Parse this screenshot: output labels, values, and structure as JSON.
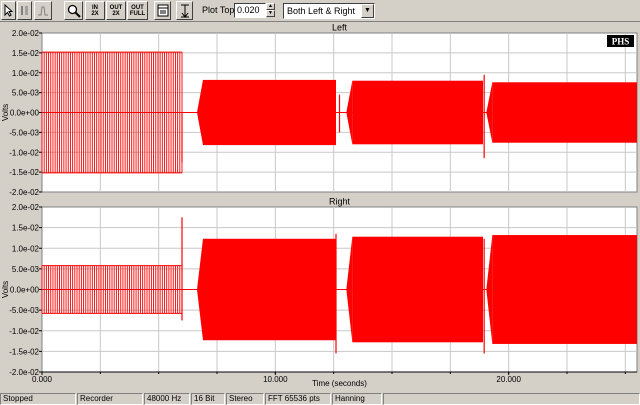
{
  "toolbar": {
    "zoom_in_label": [
      "IN",
      "2X"
    ],
    "zoom_out_label": [
      "OUT",
      "2X"
    ],
    "zoom_full_label": [
      "OUT",
      "FULL"
    ],
    "plot_top_label": "Plot Top:",
    "plot_top_value": "0.020",
    "channel_selected": "Both Left & Right"
  },
  "logo": "PHS",
  "chart_data": {
    "type": "line",
    "xlabel": "Time (seconds)",
    "x_ticks": [
      "0.000",
      "10.000",
      "20.000"
    ],
    "xlim": [
      0,
      25.5
    ],
    "color": "#ff0000",
    "panels": [
      {
        "title": "Left",
        "ylabel": "Volts",
        "ylim": [
          -0.02,
          0.02
        ],
        "y_ticks": [
          "2.0e-02",
          "1.5e-02",
          "1.0e-02",
          "5.0e-03",
          "0.0e+00",
          "-5.0e-03",
          "-1.0e-02",
          "-1.5e-02",
          "-2.0e-02"
        ],
        "segments": [
          {
            "t_start": 0.0,
            "t_end": 6.0,
            "amplitude": 0.0152,
            "style": "sparse"
          },
          {
            "t_start": 6.9,
            "t_end": 12.6,
            "amplitude": 0.0082,
            "style": "dense"
          },
          {
            "t_start": 13.3,
            "t_end": 18.9,
            "amplitude": 0.008,
            "style": "dense"
          },
          {
            "t_start": 19.3,
            "t_end": 25.5,
            "amplitude": 0.0076,
            "style": "dense"
          }
        ],
        "spikes": [
          {
            "t": 6.0,
            "top": 0.0,
            "bottom": -0.0125
          },
          {
            "t": 12.75,
            "top": 0.0045,
            "bottom": -0.005
          },
          {
            "t": 18.95,
            "top": 0.0095,
            "bottom": -0.0115
          }
        ]
      },
      {
        "title": "Right",
        "ylabel": "Volts",
        "ylim": [
          -0.02,
          0.02
        ],
        "y_ticks": [
          "2.0e-02",
          "1.5e-02",
          "1.0e-02",
          "5.0e-03",
          "0.0e+00",
          "-5.0e-03",
          "-1.0e-02",
          "-1.5e-02",
          "-2.0e-02"
        ],
        "segments": [
          {
            "t_start": 0.0,
            "t_end": 6.0,
            "amplitude": 0.0058,
            "style": "sparse"
          },
          {
            "t_start": 6.9,
            "t_end": 12.6,
            "amplitude": 0.0123,
            "style": "dense"
          },
          {
            "t_start": 13.3,
            "t_end": 18.9,
            "amplitude": 0.0128,
            "style": "dense"
          },
          {
            "t_start": 19.3,
            "t_end": 25.5,
            "amplitude": 0.0132,
            "style": "dense"
          }
        ],
        "spikes": [
          {
            "t": 6.0,
            "top": 0.0175,
            "bottom": -0.0075
          },
          {
            "t": 12.6,
            "top": 0.0135,
            "bottom": -0.0155
          },
          {
            "t": 18.95,
            "top": 0.0123,
            "bottom": -0.0155
          }
        ]
      }
    ]
  },
  "status": {
    "state": "Stopped",
    "mode": "Recorder",
    "sample_rate": "48000 Hz",
    "bits": "16 Bit",
    "channels": "Stereo",
    "fft": "FFT 65536 pts",
    "window": "Hanning"
  }
}
